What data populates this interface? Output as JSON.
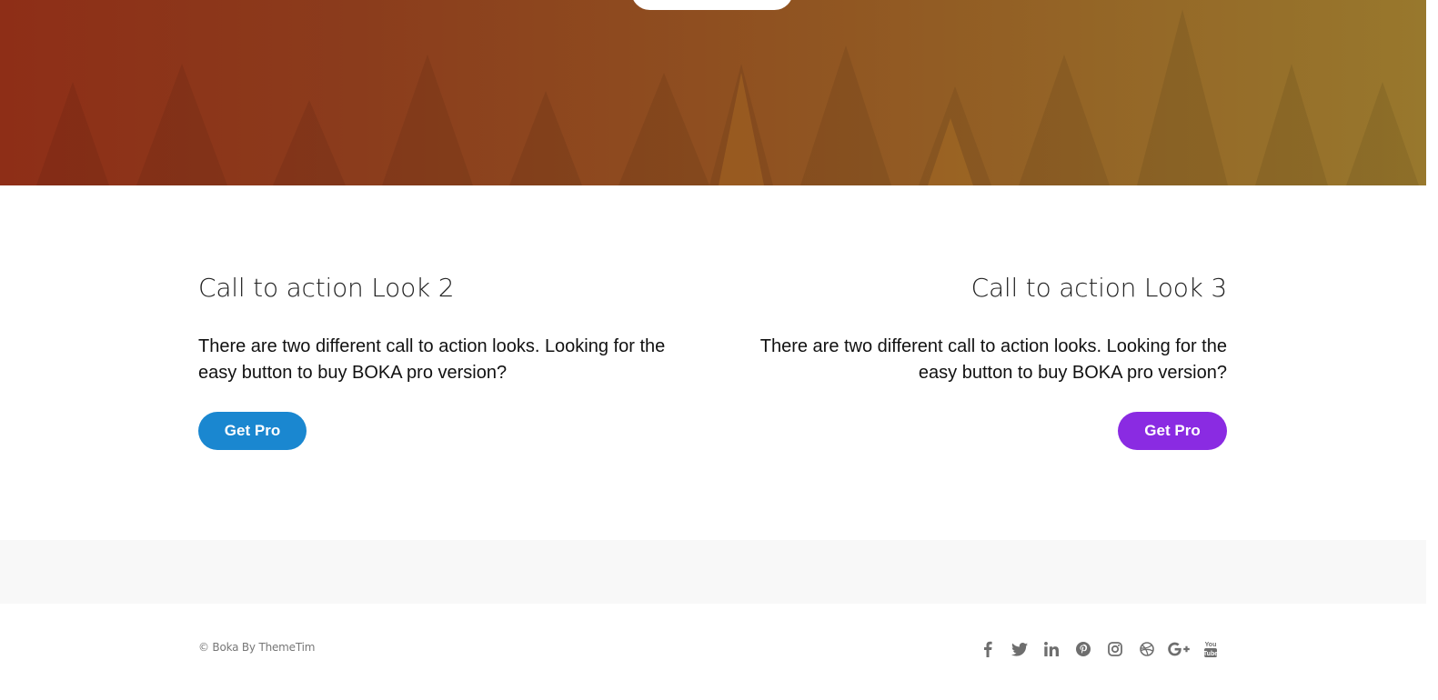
{
  "hero": {
    "colors": {
      "start": "#8e2e17",
      "end": "#98782d"
    }
  },
  "cta_left": {
    "title": "Call to action Look 2",
    "text": "There are two different call to action looks. Looking for the easy button to buy BOKA pro version?",
    "button_label": "Get Pro",
    "button_color": "#1a87d0"
  },
  "cta_right": {
    "title": "Call to action Look 3",
    "text": "There are two different call to action looks. Looking for the easy button to buy BOKA pro version?",
    "button_label": "Get Pro",
    "button_color": "#8a2be2"
  },
  "footer": {
    "copyright": "© Boka By ThemeTim",
    "social_icons": [
      "facebook-icon",
      "twitter-icon",
      "linkedin-icon",
      "pinterest-icon",
      "instagram-icon",
      "dribbble-icon",
      "google-plus-icon",
      "youtube-icon"
    ],
    "youtube_text": "You Tube"
  }
}
